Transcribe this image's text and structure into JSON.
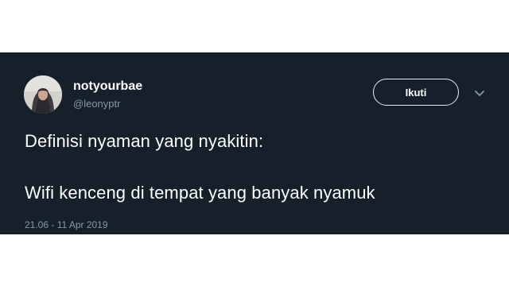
{
  "user": {
    "display_name": "notyourbae",
    "handle": "@leonyptr"
  },
  "actions": {
    "follow_label": "Ikuti"
  },
  "tweet": {
    "lines": [
      "Definisi nyaman yang nyakitin:",
      "Wifi kenceng di tempat yang banyak nyamuk"
    ],
    "timestamp": "21.06 - 11 Apr 2019"
  },
  "colors": {
    "card_background": "#15202b",
    "text_primary": "#ffffff",
    "text_secondary": "#8899a6",
    "button_border": "#e6ecf0"
  },
  "icons": {
    "menu": "chevron-down-icon",
    "avatar": "avatar"
  }
}
